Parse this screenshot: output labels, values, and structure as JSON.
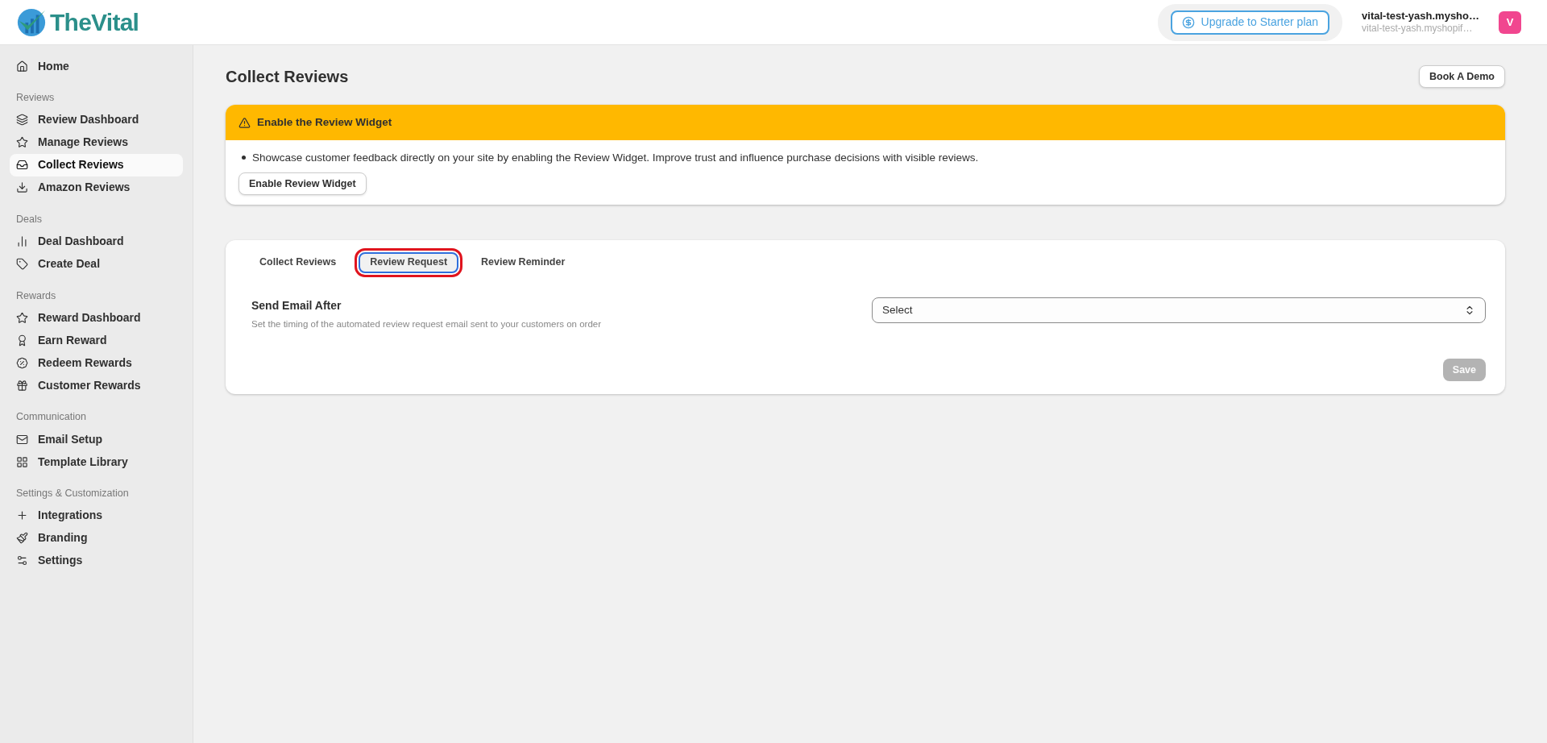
{
  "header": {
    "logo": "TheVital",
    "upgrade_button": "Upgrade to Starter plan",
    "store_name": "vital-test-yash.mysho…",
    "store_domain": "vital-test-yash.myshopif…",
    "avatar": "V"
  },
  "sidebar": {
    "groups": [
      {
        "items": [
          {
            "label": "Home",
            "selected": false
          }
        ]
      },
      {
        "heading": "Reviews",
        "items": [
          {
            "label": "Review Dashboard",
            "selected": false
          },
          {
            "label": "Manage Reviews",
            "selected": false
          },
          {
            "label": "Collect Reviews",
            "selected": true
          },
          {
            "label": "Amazon Reviews",
            "selected": false
          }
        ]
      },
      {
        "heading": "Deals",
        "items": [
          {
            "label": "Deal Dashboard",
            "selected": false
          },
          {
            "label": "Create Deal",
            "selected": false
          }
        ]
      },
      {
        "heading": "Rewards",
        "items": [
          {
            "label": "Reward Dashboard",
            "selected": false
          },
          {
            "label": "Earn Reward",
            "selected": false
          },
          {
            "label": "Redeem Rewards",
            "selected": false
          },
          {
            "label": "Customer Rewards",
            "selected": false
          }
        ]
      },
      {
        "heading": "Communication",
        "items": [
          {
            "label": "Email Setup",
            "selected": false
          },
          {
            "label": "Template Library",
            "selected": false
          }
        ]
      },
      {
        "heading": "Settings & Customization",
        "items": [
          {
            "label": "Integrations",
            "selected": false
          },
          {
            "label": "Branding",
            "selected": false
          },
          {
            "label": "Settings",
            "selected": false
          }
        ]
      }
    ]
  },
  "page": {
    "title": "Collect Reviews",
    "demo_button": "Book A Demo"
  },
  "banner": {
    "title": "Enable the Review Widget",
    "bullets": [
      "Showcase customer feedback directly on your site by enabling the Review Widget. Improve trust and influence purchase decisions with visible reviews."
    ],
    "button": "Enable Review Widget"
  },
  "tabs": [
    {
      "label": "Collect Reviews",
      "selected": false,
      "highlighted": false
    },
    {
      "label": "Review Request",
      "selected": true,
      "highlighted": true
    },
    {
      "label": "Review Reminder",
      "selected": false,
      "highlighted": false
    }
  ],
  "setting": {
    "label": "Send Email After",
    "description": "Set the timing of the automated review request email sent to your customers on order",
    "select": {
      "value": "Select"
    }
  },
  "save_button": {
    "label": "Save",
    "disabled": true
  }
}
